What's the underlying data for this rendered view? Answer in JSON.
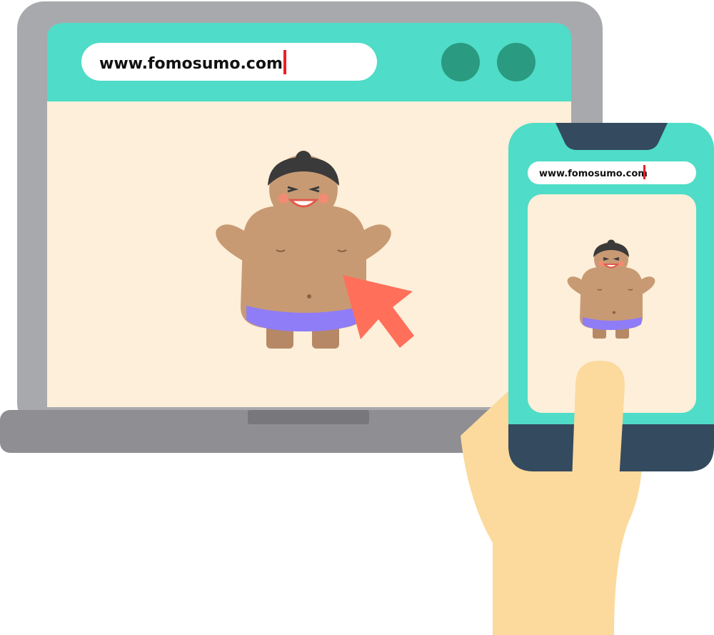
{
  "laptop": {
    "address_bar": {
      "url": "www.fomosumo.com"
    },
    "window_buttons": [
      "circle-button",
      "circle-button"
    ]
  },
  "phone": {
    "address_bar": {
      "url": "www.fomosumo.com"
    }
  },
  "colors": {
    "laptop_frame": "#a8a9ad",
    "laptop_base": "#8e8e93",
    "browser_bar": "#4fdcc8",
    "browser_button": "#2a9a80",
    "page_background": "#fdefd9",
    "phone_body": "#4fdcc8",
    "phone_dark": "#344a5e",
    "skin": "#c89a74",
    "hair": "#3a3a3a",
    "mawashi": "#8f7cf7",
    "pointer": "#ff6f5a",
    "hand": "#fcd99c"
  },
  "icons": {
    "pointer": "arrow-pointer-icon",
    "character": "sumo-wrestler-icon"
  }
}
